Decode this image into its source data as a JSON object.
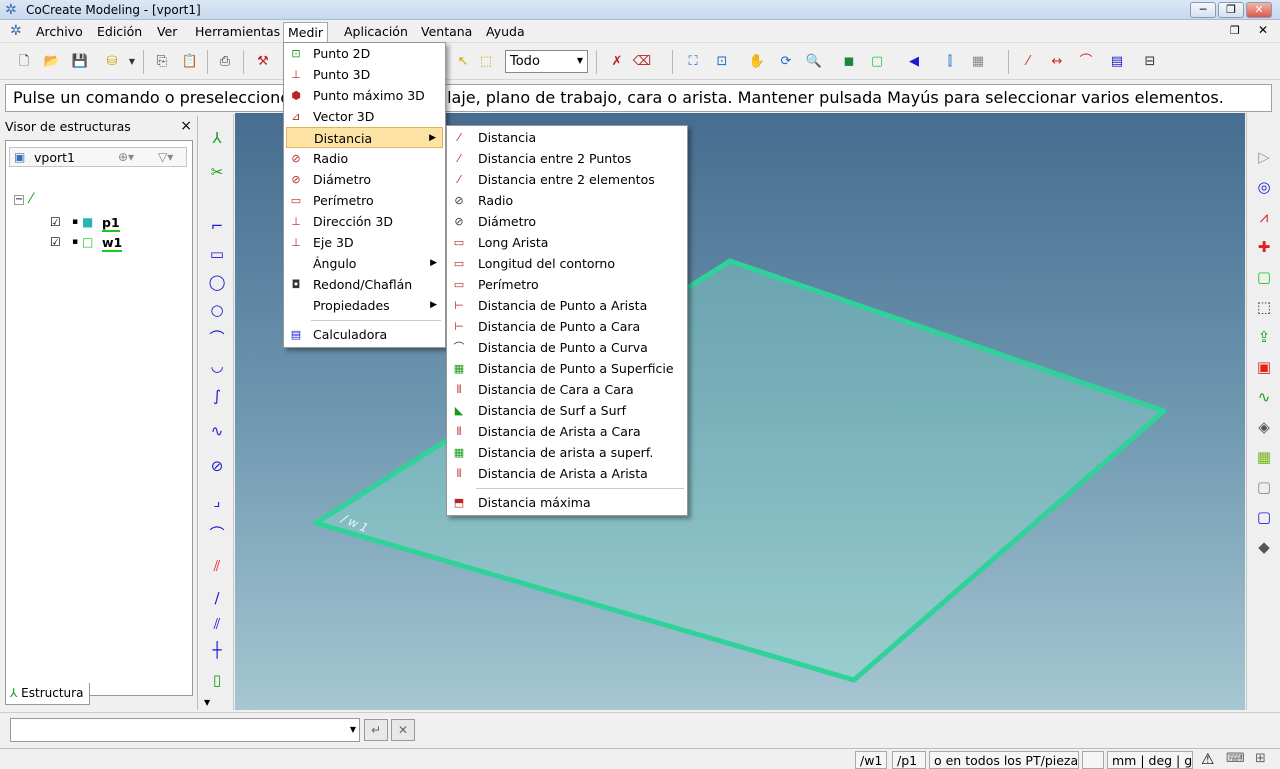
{
  "window": {
    "title": "CoCreate Modeling - [vport1]",
    "min": "─",
    "max": "❐",
    "close": "✕"
  },
  "menubar": {
    "items": [
      "Archivo",
      "Edición",
      "Ver",
      "Herramientas",
      "Medir",
      "Aplicación",
      "Ventana",
      "Ayuda"
    ]
  },
  "toolbar": {
    "filter_value": "Todo"
  },
  "prompt": "Pulse un comando o preseleccione una pieza, ensamblaje, plano de trabajo, cara o arista. Mantener pulsada Mayús para seleccionar varios elementos.",
  "structure_panel": {
    "title": "Visor de estructuras",
    "root": "vport1",
    "items": [
      {
        "label": "p1"
      },
      {
        "label": "w1"
      }
    ],
    "tab": "Estructura"
  },
  "viewport": {
    "workplane_label": "/w1",
    "accent": "#2fd39a"
  },
  "medir_menu": {
    "items": [
      {
        "label": "Punto 2D",
        "icon": "point-2d-icon"
      },
      {
        "label": "Punto 3D",
        "icon": "point-3d-icon"
      },
      {
        "label": "Punto máximo 3D",
        "icon": "max-point-icon"
      },
      {
        "label": "Vector 3D",
        "icon": "vector-icon"
      },
      {
        "label": "Distancia",
        "icon": "distance-icon"
      },
      {
        "label": "Radio",
        "icon": "radius-icon"
      },
      {
        "label": "Diámetro",
        "icon": "diameter-icon"
      },
      {
        "label": "Perímetro",
        "icon": "perimeter-icon"
      },
      {
        "label": "Dirección 3D",
        "icon": "direction-icon"
      },
      {
        "label": "Eje 3D",
        "icon": "axis-icon"
      },
      {
        "label": "Ángulo",
        "icon": ""
      },
      {
        "label": "Redond/Chaflán",
        "icon": "fillet-icon"
      },
      {
        "label": "Propiedades",
        "icon": ""
      }
    ],
    "calc": "Calculadora"
  },
  "distancia_menu": {
    "items": [
      "Distancia",
      "Distancia entre 2 Puntos",
      "Distancia entre 2 elementos",
      "Radio",
      "Diámetro",
      "Long Arista",
      "Longitud del contorno",
      "Perímetro",
      "Distancia de Punto a Arista",
      "Distancia de Punto a Cara",
      "Distancia de Punto a Curva",
      "Distancia de Punto a Superficie",
      "Distancia de Cara a Cara",
      "Distancia de  Surf a Surf",
      "Distancia de Arista a Cara",
      "Distancia de arista a superf.",
      "Distancia de Arista a Arista"
    ],
    "max": "Distancia máxima"
  },
  "status": {
    "wp": "/w1",
    "part": "/p1",
    "sel": "o en todos los PT/piezas",
    "units": "mm | deg | g"
  }
}
